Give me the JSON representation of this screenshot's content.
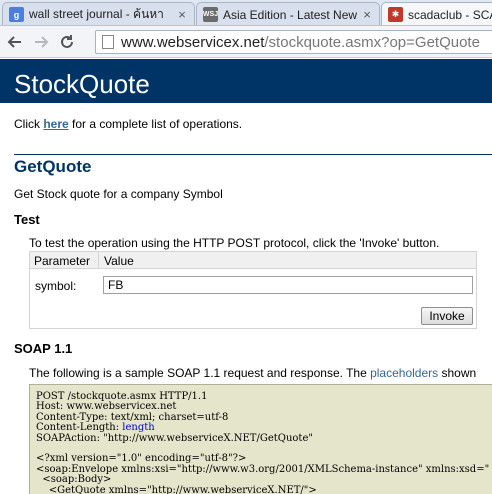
{
  "browser": {
    "tabs": [
      {
        "title": "wall street journal - ค้นหา",
        "icon": "google-g-icon",
        "close": "×"
      },
      {
        "title": "Asia Edition - Latest New",
        "icon": "wsj-icon",
        "close": "×"
      },
      {
        "title": "scadaclub - SCA",
        "icon": "joomla-icon",
        "close": "×"
      }
    ],
    "url_host": "www.webservicex.net",
    "url_path": "/stockquote.asmx?op=GetQuote"
  },
  "page": {
    "banner_title": "StockQuote",
    "intro_before": "Click ",
    "intro_link": "here",
    "intro_after": " for a complete list of operations.",
    "operation_title": "GetQuote",
    "operation_description": "Get Stock quote for a company Symbol",
    "test_heading": "Test",
    "test_instructions": "To test the operation using the HTTP POST protocol, click the 'Invoke' button.",
    "table_header_parameter": "Parameter",
    "table_header_value": "Value",
    "param_label": "symbol:",
    "param_value": "FB",
    "invoke_label": "Invoke",
    "soap_heading": "SOAP 1.1",
    "soap_text_before": "The following is a sample SOAP 1.1 request and response. The ",
    "soap_text_link": "placeholders",
    "soap_text_after": " shown",
    "code_lines": [
      "POST /stockquote.asmx HTTP/1.1",
      "Host: www.webservicex.net",
      "Content-Type: text/xml; charset=utf-8",
      "Content-Length: ",
      "SOAPAction: \"http://www.webserviceX.NET/GetQuote\"",
      "",
      "<?xml version=\"1.0\" encoding=\"utf-8\"?>",
      "<soap:Envelope xmlns:xsi=\"http://www.w3.org/2001/XMLSchema-instance\" xmlns:xsd=\"",
      "  <soap:Body>",
      "    <GetQuote xmlns=\"http://www.webserviceX.NET/\">"
    ],
    "code_placeholder_length": "length"
  },
  "colors": {
    "banner": "#003366",
    "link": "#336699",
    "code_bg": "#e5e5cc"
  }
}
